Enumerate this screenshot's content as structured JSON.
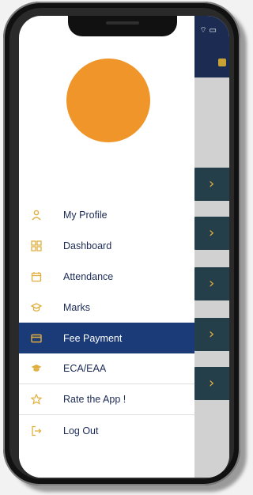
{
  "drawer": {
    "avatar_color": "#f0952a",
    "items": [
      {
        "label": "My Profile",
        "icon": "person-icon"
      },
      {
        "label": "Dashboard",
        "icon": "dashboard-icon"
      },
      {
        "label": "Attendance",
        "icon": "calendar-icon"
      },
      {
        "label": "Marks",
        "icon": "graduation-cap-icon"
      },
      {
        "label": "Fee Payment",
        "icon": "credit-card-icon",
        "active": true
      },
      {
        "label": "ECA/EAA",
        "icon": "mortarboard-icon"
      },
      {
        "label": "Rate the App !",
        "icon": "star-icon"
      },
      {
        "label": "Log Out",
        "icon": "logout-icon"
      }
    ]
  },
  "colors": {
    "accent": "#e0ae3e",
    "active_bg": "#1b3a78",
    "header": "#1b2b52"
  }
}
